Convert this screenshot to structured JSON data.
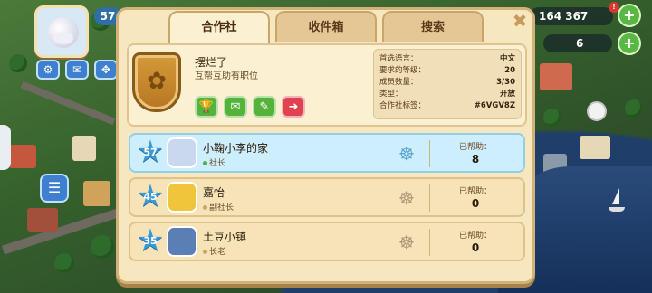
{
  "hud": {
    "player_level": "57",
    "coins": "164 367",
    "coins_badge": "!",
    "gems": "6",
    "plus_label": "+",
    "buttons": [
      {
        "icon": "gear-icon",
        "glyph": "⚙"
      },
      {
        "icon": "mail-icon",
        "glyph": "✉"
      },
      {
        "icon": "move-icon",
        "glyph": "✥"
      }
    ],
    "chat_glyph": "☰"
  },
  "tabs": [
    {
      "label": "合作社",
      "active": true
    },
    {
      "label": "收件箱",
      "active": false
    },
    {
      "label": "搜索",
      "active": false
    }
  ],
  "close_glyph": "✖",
  "coop": {
    "name": "摆烂了",
    "description": "互帮互助有职位",
    "crest_glyph": "✿",
    "actions": [
      {
        "icon": "trophy-icon",
        "glyph": "🏆",
        "color": "#55b33a"
      },
      {
        "icon": "mail-icon",
        "glyph": "✉",
        "color": "#55b33a"
      },
      {
        "icon": "pencil-icon",
        "glyph": "✎",
        "color": "#55b33a"
      },
      {
        "icon": "exit-icon",
        "glyph": "➜",
        "color": "#e0434f"
      }
    ],
    "stats": [
      {
        "label": "首选语言：",
        "value": "中文"
      },
      {
        "label": "要求的等级：",
        "value": "20"
      },
      {
        "label": "成员数量：",
        "value": "3/30"
      },
      {
        "label": "类型：",
        "value": "开放"
      },
      {
        "label": "合作社标签：",
        "value": "#6VGV8Z"
      }
    ]
  },
  "members": [
    {
      "level": "57",
      "name": "小鞠小李的家",
      "role": "社长",
      "role_color": "#4caf50",
      "help_label": "已帮助：",
      "help_count": "8",
      "highlight": true,
      "avatar_bg": "#c9d8ee"
    },
    {
      "level": "45",
      "name": "嘉怡",
      "role": "副社长",
      "role_color": "#c9a568",
      "help_label": "已帮助：",
      "help_count": "0",
      "highlight": false,
      "avatar_bg": "#f0c53a"
    },
    {
      "level": "35",
      "name": "土豆小镇",
      "role": "长老",
      "role_color": "#c9a568",
      "help_label": "已帮助：",
      "help_count": "0",
      "highlight": false,
      "avatar_bg": "#5a7fb5"
    }
  ],
  "member_glyphs": {
    "star": "★",
    "wheel": "☸"
  }
}
